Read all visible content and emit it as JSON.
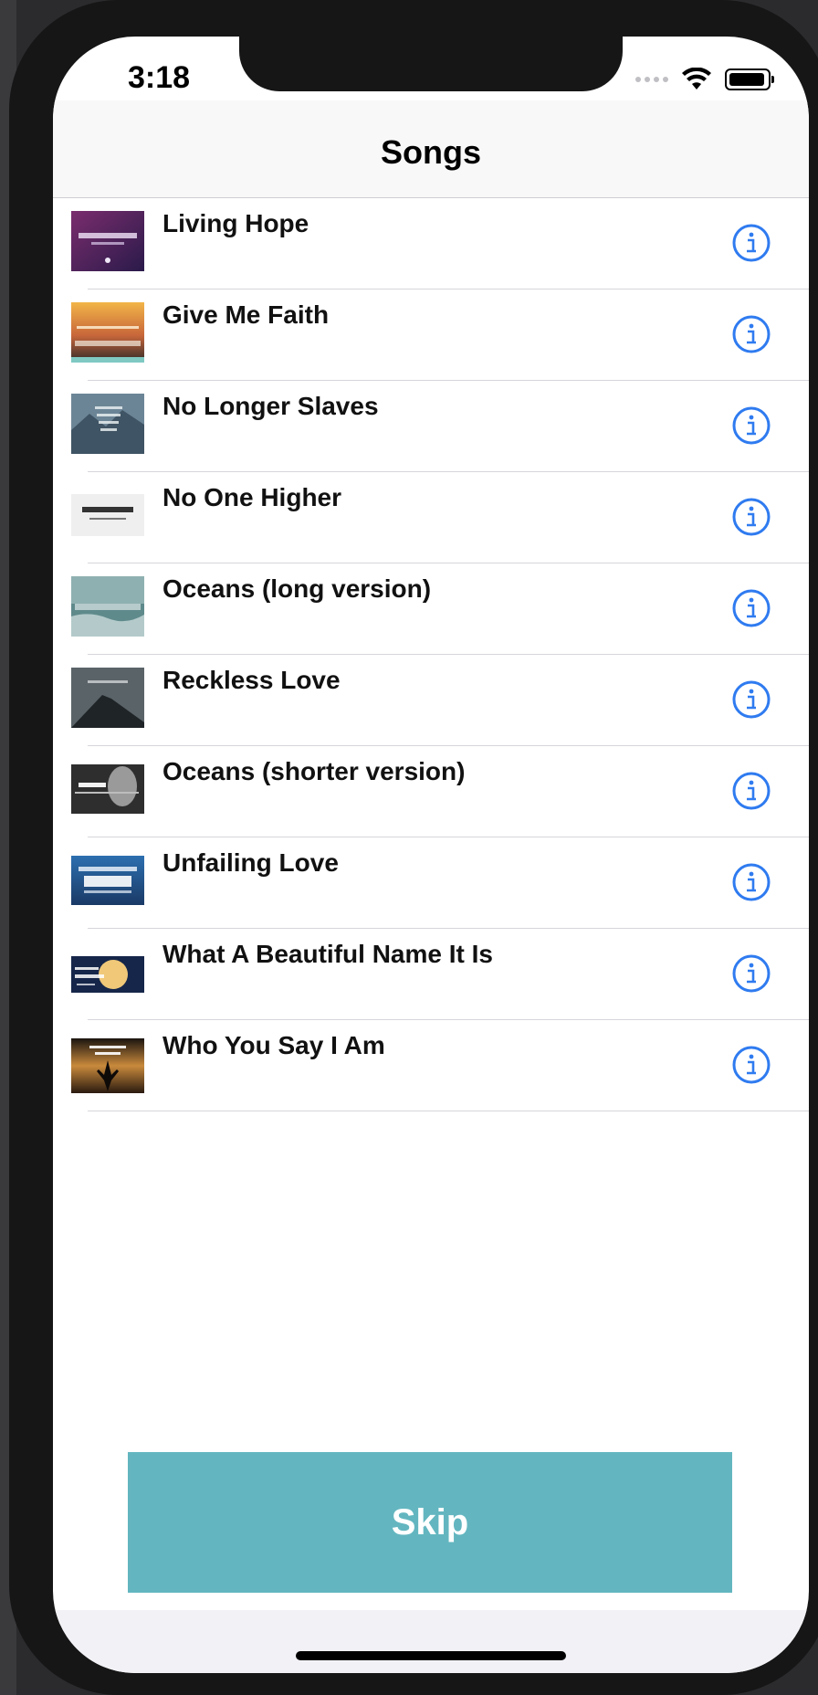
{
  "status_bar": {
    "time": "3:18"
  },
  "navbar": {
    "title": "Songs"
  },
  "songs": [
    {
      "title": "Living Hope"
    },
    {
      "title": "Give Me Faith"
    },
    {
      "title": "No Longer Slaves"
    },
    {
      "title": "No One Higher"
    },
    {
      "title": "Oceans (long version)"
    },
    {
      "title": "Reckless Love"
    },
    {
      "title": "Oceans (shorter version)"
    },
    {
      "title": "Unfailing Love"
    },
    {
      "title": "What A Beautiful Name It Is"
    },
    {
      "title": "Who You Say I Am"
    }
  ],
  "actions": {
    "skip_label": "Skip"
  },
  "colors": {
    "accent": "#2f7bf0",
    "skip": "#63b6c0"
  }
}
